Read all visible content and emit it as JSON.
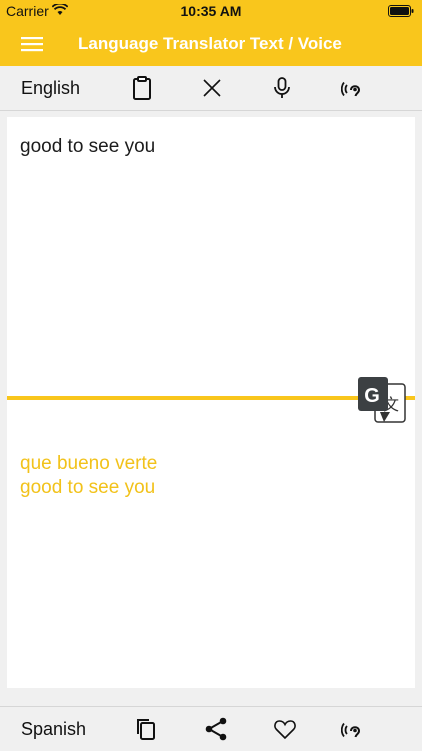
{
  "status_bar": {
    "carrier": "Carrier",
    "time": "10:35 AM"
  },
  "nav": {
    "title": "Language Translator Text / Voice",
    "menu_icon": "hamburger-icon"
  },
  "source": {
    "language": "English",
    "text": "good to see you",
    "icons": [
      "clipboard-icon",
      "close-icon",
      "microphone-icon",
      "listen-icon"
    ]
  },
  "target": {
    "language": "Spanish",
    "text_line1": "que bueno verte",
    "text_line2": "good to see you",
    "icons": [
      "copy-icon",
      "share-icon",
      "heart-icon",
      "listen-icon"
    ]
  },
  "colors": {
    "accent": "#f9c61c",
    "output_text": "#f2c21a"
  }
}
